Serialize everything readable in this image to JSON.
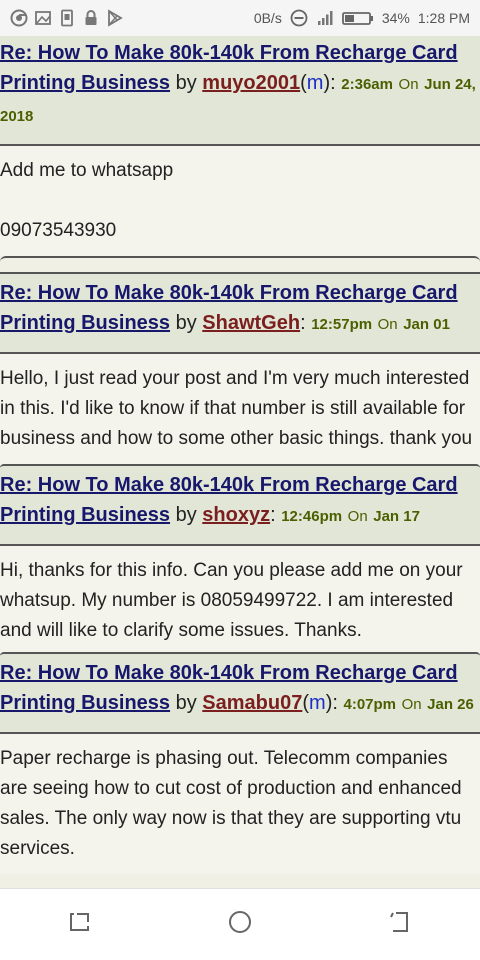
{
  "status_bar": {
    "network_speed": "0B/s",
    "battery": "34%",
    "time": "1:28 PM",
    "icons": [
      "chrome-icon",
      "gallery-icon",
      "sim-icon",
      "lock-icon",
      "play-store-icon",
      "do-not-disturb-icon",
      "signal-icon",
      "battery-icon"
    ]
  },
  "posts": [
    {
      "topic": "Re: How To Make 80k-140k From Recharge Card Printing Business",
      "by": "by",
      "user": "muyo2001",
      "mod": "m",
      "time": "2:36am",
      "on": "On",
      "date": "Jun 24, 2018",
      "body": [
        "Add me to whatsapp",
        "",
        "09073543930"
      ]
    },
    {
      "topic": "Re: How To Make 80k-140k From Recharge Card Printing Business",
      "by": "by",
      "user": "ShawtGeh",
      "time": "12:57pm",
      "on": "On",
      "date": "Jan 01",
      "body": [
        "Hello, I just read your post and I'm very much interested in this. I'd like to know if that number is still available for business and how to some other basic things. thank you"
      ]
    },
    {
      "topic": "Re: How To Make 80k-140k From Recharge Card Printing Business",
      "by": "by",
      "user": "shoxyz",
      "time": "12:46pm",
      "on": "On",
      "date": "Jan 17",
      "body": [
        "Hi, thanks for this info. Can you please add me on your whatsup. My number is 08059499722. I am interested and will like to clarify some issues. Thanks."
      ]
    },
    {
      "topic": "Re: How To Make 80k-140k From Recharge Card Printing Business",
      "by": "by",
      "user": "Samabu07",
      "mod": "m",
      "time": "4:07pm",
      "on": "On",
      "date": "Jan 26",
      "body": [
        "Paper recharge is phasing out. Telecomm companies are seeing how to cut cost of production and enhanced sales. The only way now is that they are supporting vtu services."
      ]
    }
  ],
  "nav_bar": {
    "buttons": [
      "recent-apps-icon",
      "home-icon",
      "back-icon"
    ]
  }
}
